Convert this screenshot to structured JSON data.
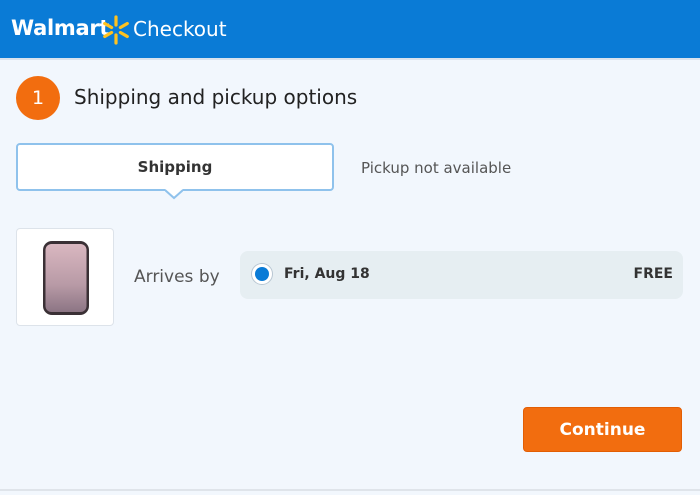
{
  "header": {
    "brand": "Walmart",
    "title": "Checkout",
    "brand_color": "#0a7bd6",
    "spark_color": "#ffc220",
    "spark_icon": "walmart-spark-icon"
  },
  "step": {
    "number": "1",
    "title": "Shipping and pickup options",
    "accent_color": "#f26d0f"
  },
  "tabs": {
    "shipping": "Shipping",
    "pickup": "Pickup not available"
  },
  "item": {
    "image_icon": "smartphone-product-image",
    "arrives_label": "Arrives by"
  },
  "shipping_option": {
    "date": "Fri, Aug 18",
    "price": "FREE",
    "selected": true
  },
  "actions": {
    "continue": "Continue"
  }
}
